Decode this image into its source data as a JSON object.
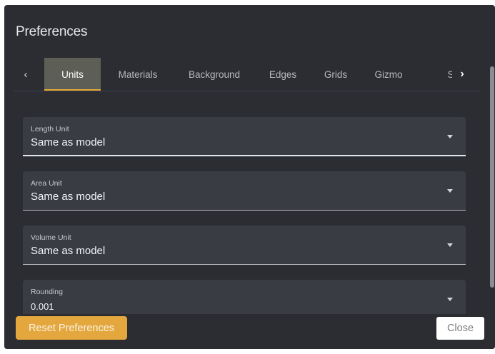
{
  "dialog": {
    "title": "Preferences"
  },
  "tabs": {
    "prev_icon": "chevron-left-icon",
    "next_icon": "chevron-right-icon",
    "items": [
      {
        "label": "Units",
        "active": true
      },
      {
        "label": "Materials",
        "active": false
      },
      {
        "label": "Background",
        "active": false
      },
      {
        "label": "Edges",
        "active": false
      },
      {
        "label": "Grids",
        "active": false
      },
      {
        "label": "Gizmo",
        "active": false
      },
      {
        "label": "S",
        "active": false
      }
    ]
  },
  "fields": [
    {
      "label": "Length Unit",
      "value": "Same as model"
    },
    {
      "label": "Area Unit",
      "value": "Same as model"
    },
    {
      "label": "Volume Unit",
      "value": "Same as model"
    },
    {
      "label": "Rounding",
      "value": "0.001"
    }
  ],
  "footer": {
    "reset_label": "Reset Preferences",
    "close_label": "Close"
  },
  "colors": {
    "dialog_bg": "#2b2d33",
    "field_bg": "#3a3c44",
    "accent": "#e3a73d",
    "active_tab_bg": "#5d5e55"
  }
}
